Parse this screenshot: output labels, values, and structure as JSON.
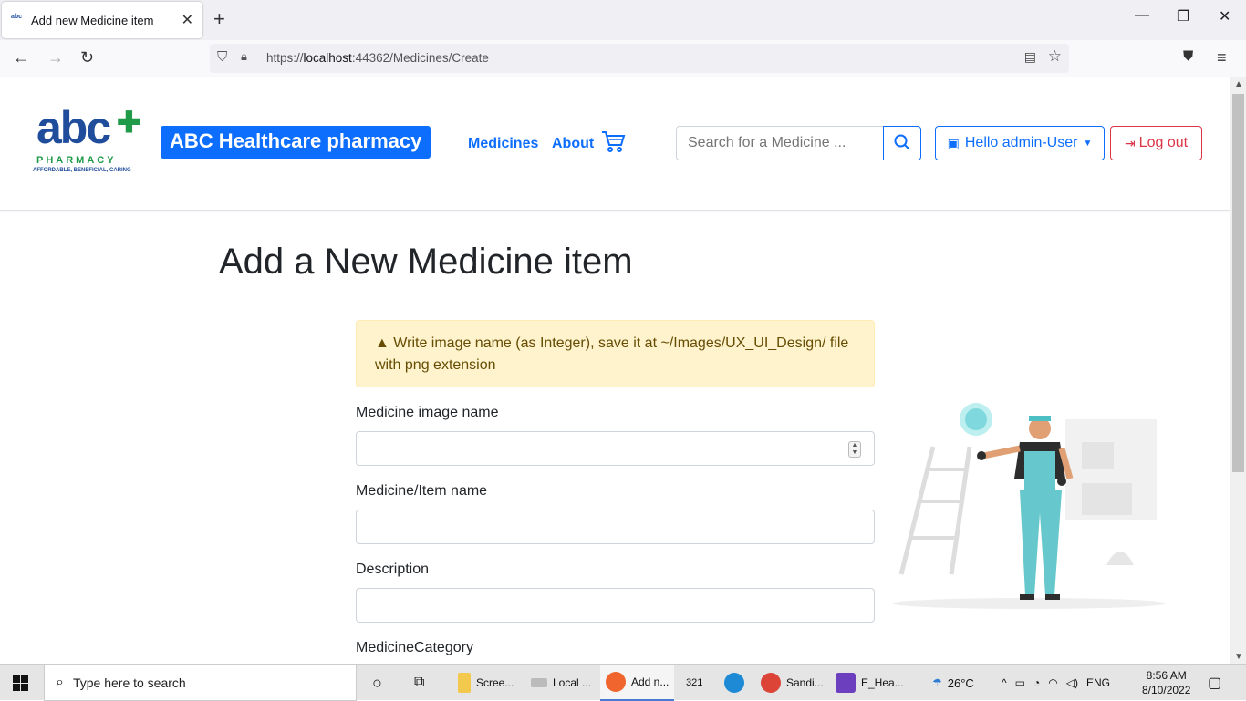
{
  "browser": {
    "tab_title": "Add new Medicine item",
    "favicon_text": "abc",
    "url_prefix": "https://",
    "url_host": "localhost",
    "url_rest": ":44362/Medicines/Create"
  },
  "header": {
    "logo_main": "abc",
    "logo_sub": "PHARMACY",
    "logo_tagline": "AFFORDABLE, BENEFICIAL, CARING",
    "brand": "ABC Healthcare pharmacy",
    "nav": {
      "medicines": "Medicines",
      "about": "About"
    },
    "search_placeholder": "Search for a Medicine ...",
    "user_menu": "Hello admin-User",
    "logout": "Log out"
  },
  "page": {
    "title": "Add a New Medicine item",
    "alert": "Write image name (as Integer), save it at ~/Images/UX_UI_Design/ file with png extension",
    "fields": {
      "image_name": "Medicine image name",
      "item_name": "Medicine/Item name",
      "description": "Description",
      "category": "MedicineCategory"
    }
  },
  "taskbar": {
    "search_placeholder": "Type here to search",
    "apps": [
      "Scree...",
      "Local ...",
      "Add n...",
      "Sandi...",
      "E_Hea..."
    ],
    "weather": "26°C",
    "lang": "ENG",
    "time": "8:56 AM",
    "date": "8/10/2022"
  },
  "colors": {
    "primary": "#0d6efd",
    "danger": "#dc3545",
    "alert_bg": "#fff3cd",
    "alert_text": "#664d03"
  }
}
